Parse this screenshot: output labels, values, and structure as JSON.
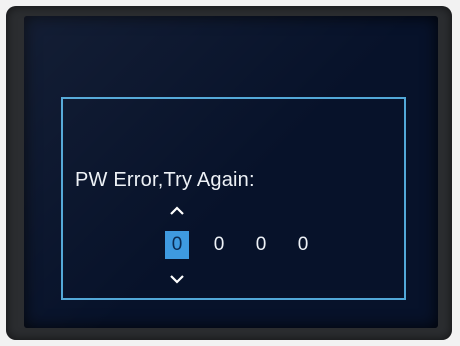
{
  "dialog": {
    "prompt": "PW Error,Try Again:"
  },
  "password": {
    "digits": [
      "0",
      "0",
      "0",
      "0"
    ],
    "selected_index": 0
  },
  "colors": {
    "border": "#52a8d8",
    "highlight": "#3e9ae0",
    "background": "#07122a"
  },
  "icons": {
    "increment": "chevron-up-icon",
    "decrement": "chevron-down-icon"
  }
}
